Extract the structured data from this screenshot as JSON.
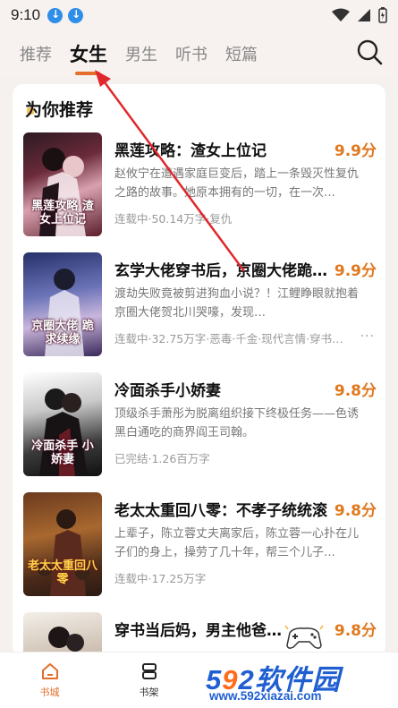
{
  "status": {
    "time": "9:10"
  },
  "tabs": [
    {
      "label": "推荐",
      "active": false
    },
    {
      "label": "女生",
      "active": true
    },
    {
      "label": "男生",
      "active": false
    },
    {
      "label": "听书",
      "active": false
    },
    {
      "label": "短篇",
      "active": false
    }
  ],
  "section": {
    "title": "为你推荐"
  },
  "books": [
    {
      "title": "黑莲攻略：渣女上位记",
      "score": "9.9分",
      "desc": "赵攸宁在遭遇家庭巨变后，踏上一条毁灭性复仇之路的故事。她原本拥有的一切，在一次…",
      "meta": "连载中·50.14万字·复仇",
      "cover_text": "黑莲攻略 渣女上位记"
    },
    {
      "title": "玄学大佬穿书后，京圈大佬跪求续缘",
      "score": "9.9分",
      "desc": "渡劫失败竟被剪进狗血小说？！江鲤睁眼就抱着京圈大佬贺北川哭嚎，发现…",
      "meta": "连载中·32.75万字·恶毒·千金·现代言情·穿书…",
      "cover_text": "京圈大佬 跪求续缘"
    },
    {
      "title": "冷面杀手小娇妻",
      "score": "9.8分",
      "desc": "顶级杀手萧彤为脱离组织接下终极任务——色诱黑白通吃的商界阎王司翰。",
      "meta": "已完结·1.26百万字",
      "cover_text": "冷面杀手 小娇妻"
    },
    {
      "title": "老太太重回八零：不孝子统统滚",
      "score": "9.8分",
      "desc": "上辈子，陈立蓉丈夫离家后，陈立蓉一心扑在儿子们的身上，操劳了几十年，帮三个儿子…",
      "meta": "连载中·17.25万字",
      "cover_text": "老太太重回八零"
    },
    {
      "title": "穿书当后妈，男主他爸太撩了",
      "score": "9.8分",
      "desc": "",
      "meta": "",
      "cover_text": ""
    }
  ],
  "nav": [
    {
      "label": "书城",
      "icon": "home-icon",
      "active": true
    },
    {
      "label": "书架",
      "icon": "bookshelf-icon",
      "active": false
    },
    {
      "label": "",
      "icon": "",
      "active": false
    },
    {
      "label": "",
      "icon": "",
      "active": false
    }
  ],
  "watermark": {
    "big": "592软件园",
    "url": "www.592xiazai.com"
  },
  "colors": {
    "accent": "#e36f2a",
    "score": "#e0791e",
    "watermark_blue": "#1f5fd1"
  }
}
